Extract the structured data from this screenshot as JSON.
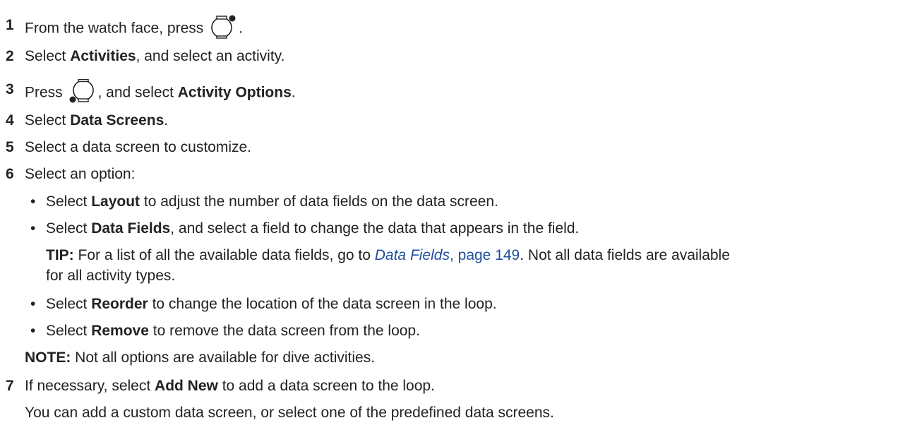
{
  "steps": [
    {
      "num": "1",
      "a": "From the watch face, press ",
      "icon": "watch-button-top-right-icon",
      "b": "."
    },
    {
      "num": "2",
      "a": "Select ",
      "bold": "Activities",
      "b": ", and select an activity."
    },
    {
      "num": "3",
      "a": "Press ",
      "icon": "watch-button-bottom-left-icon",
      "b": ", and select ",
      "bold": "Activity Options",
      "c": "."
    },
    {
      "num": "4",
      "a": "Select ",
      "bold": "Data Screens",
      "b": "."
    },
    {
      "num": "5",
      "text": "Select a data screen to customize."
    },
    {
      "num": "6",
      "text": "Select an option:"
    },
    {
      "num": "7",
      "a": "If necessary, select ",
      "bold": "Add New",
      "b": " to add a data screen to the loop."
    }
  ],
  "options": [
    {
      "a": "Select ",
      "bold": "Layout",
      "b": " to adjust the number of data fields on the data screen."
    },
    {
      "a": "Select ",
      "bold": "Data Fields",
      "b": ", and select a field to change the data that appears in the field."
    },
    {
      "a": "Select ",
      "bold": "Reorder",
      "b": " to change the location of the data screen in the loop."
    },
    {
      "a": "Select ",
      "bold": "Remove",
      "b": " to remove the data screen from the loop."
    }
  ],
  "tip": {
    "label": "TIP:",
    "a": " For a list of all the available data fields, go to ",
    "link": "Data Fields",
    "page_link": ", page 149",
    "b": ". Not all data fields are available",
    "line2": "for all activity types."
  },
  "note": {
    "label": "NOTE:",
    "text": " Not all options are available for dive activities."
  },
  "step7_detail": "You can add a custom data screen, or select one of the predefined data screens.",
  "bullet": "•"
}
